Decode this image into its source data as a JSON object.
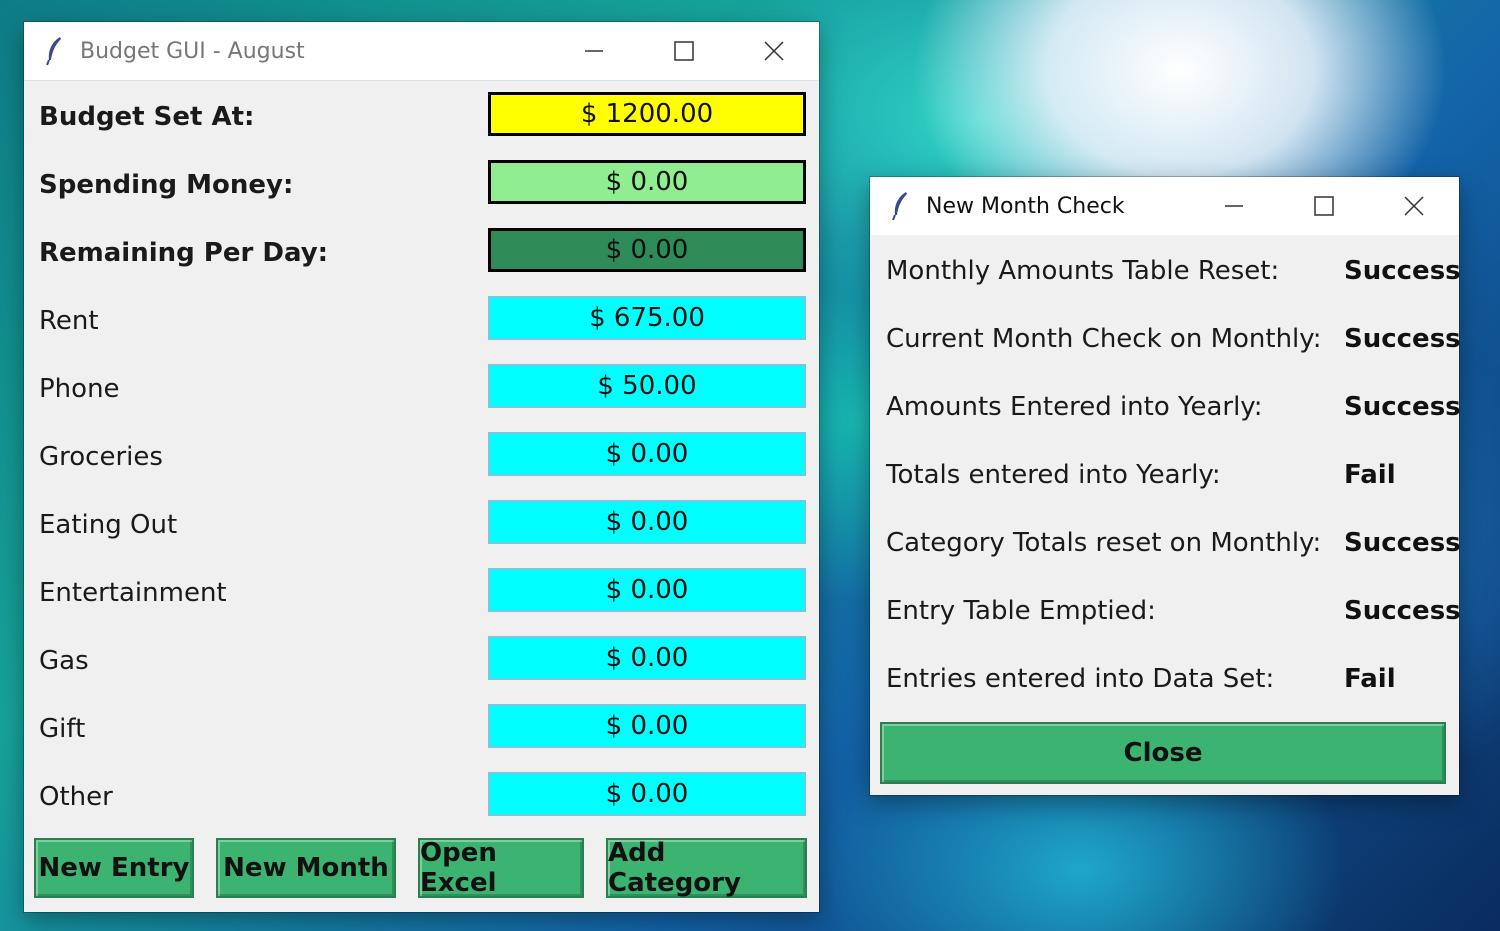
{
  "budget_window": {
    "title": "Budget GUI - August",
    "rows": [
      {
        "label": "Budget Set At:",
        "value": "$ 1200.00"
      },
      {
        "label": "Spending Money:",
        "value": "$ 0.00"
      },
      {
        "label": "Remaining Per Day:",
        "value": "$ 0.00"
      },
      {
        "label": "Rent",
        "value": "$ 675.00"
      },
      {
        "label": "Phone",
        "value": "$ 50.00"
      },
      {
        "label": "Groceries",
        "value": "$ 0.00"
      },
      {
        "label": "Eating Out",
        "value": "$ 0.00"
      },
      {
        "label": "Entertainment",
        "value": "$ 0.00"
      },
      {
        "label": "Gas",
        "value": "$ 0.00"
      },
      {
        "label": "Gift",
        "value": "$ 0.00"
      },
      {
        "label": "Other",
        "value": "$ 0.00"
      }
    ],
    "buttons": {
      "new_entry": "New Entry",
      "new_month": "New Month",
      "open_excel": "Open Excel",
      "add_category": "Add Category"
    },
    "colors": {
      "budget": "#ffff00",
      "spending": "#90ee90",
      "remaining": "#2e8b57",
      "category": "#00ffff",
      "button": "#3cb371"
    }
  },
  "check_window": {
    "title": "New Month Check",
    "rows": [
      {
        "label": "Monthly Amounts Table Reset:",
        "status": "Success"
      },
      {
        "label": "Current Month Check on Monthly:",
        "status": "Success"
      },
      {
        "label": "Amounts Entered into Yearly:",
        "status": "Success"
      },
      {
        "label": "Totals entered into Yearly:",
        "status": "Fail"
      },
      {
        "label": "Category Totals reset on Monthly:",
        "status": "Success"
      },
      {
        "label": "Entry Table Emptied:",
        "status": "Success"
      },
      {
        "label": "Entries entered into Data Set:",
        "status": "Fail"
      }
    ],
    "close_label": "Close"
  },
  "icons": [
    "feather-icon",
    "minimize-icon",
    "maximize-icon",
    "close-icon"
  ]
}
